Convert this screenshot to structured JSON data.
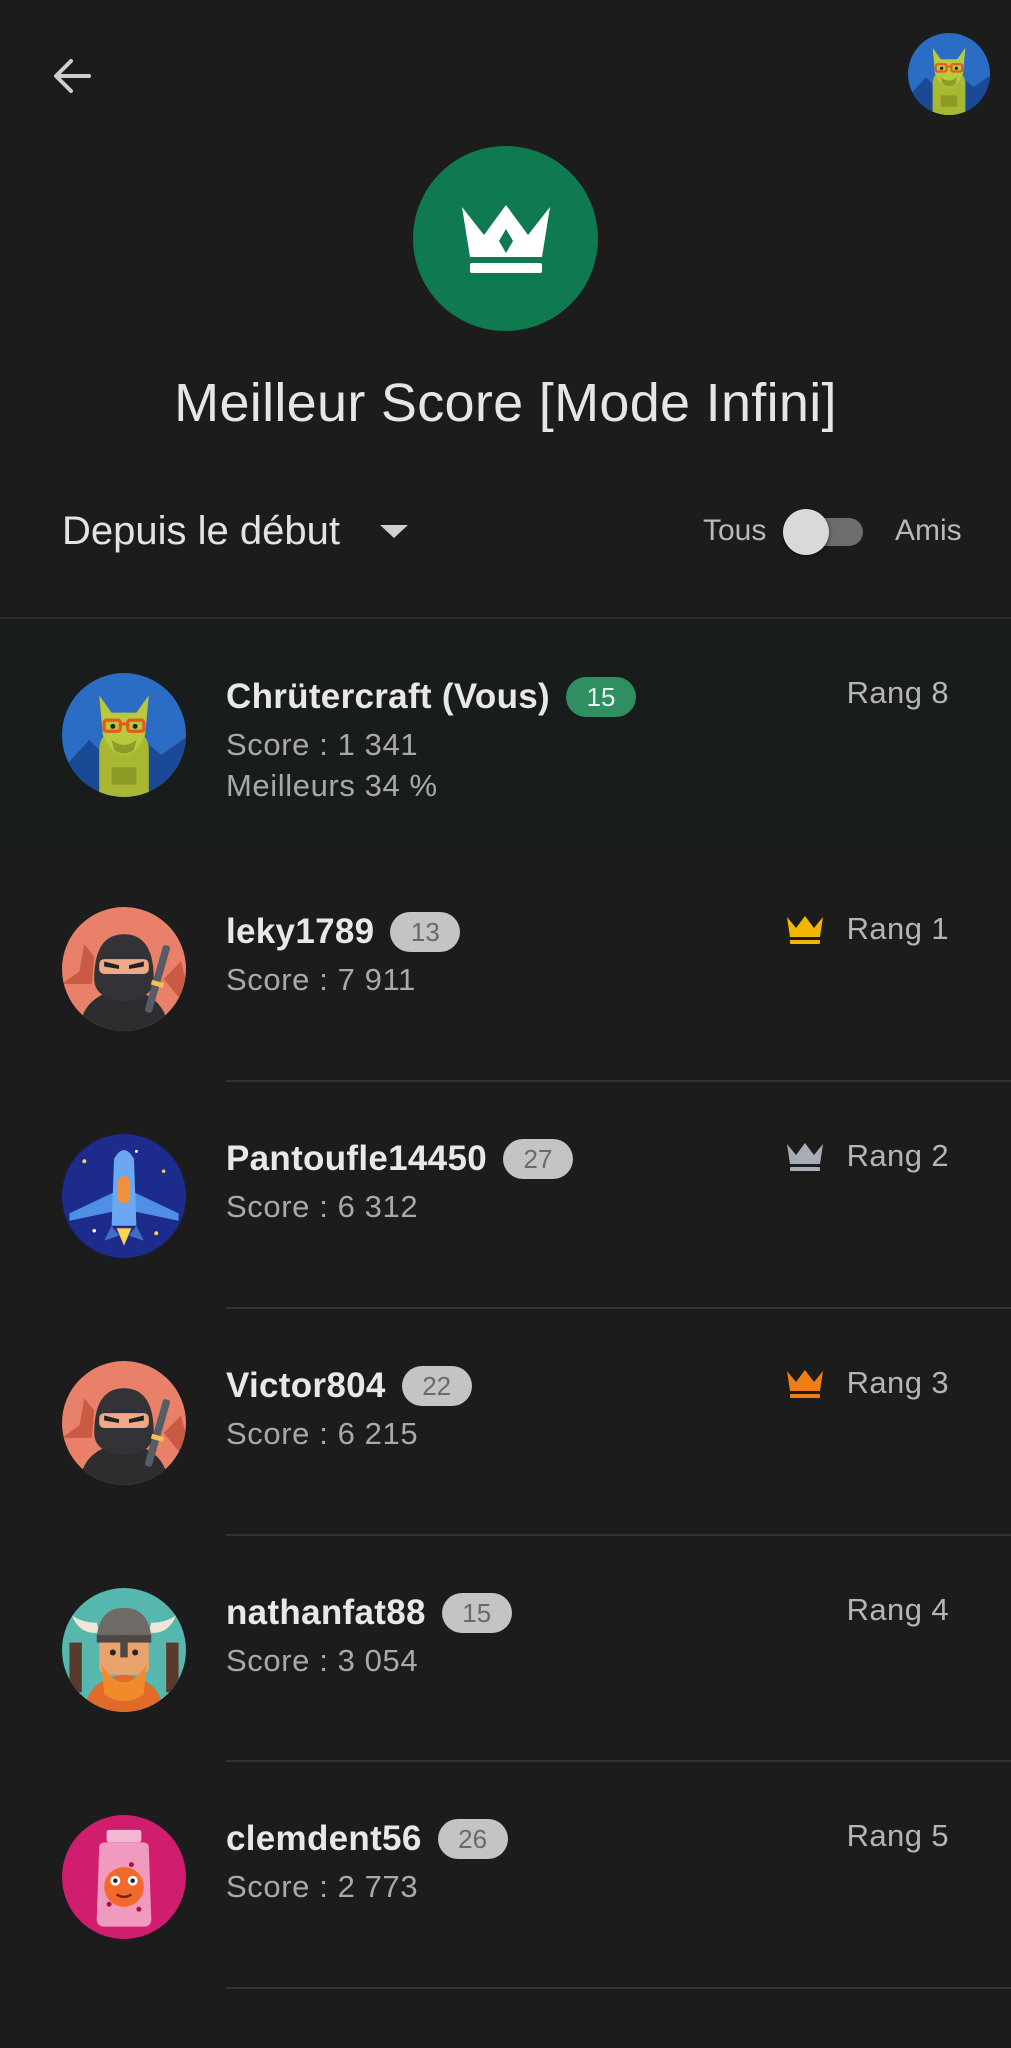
{
  "header": {
    "back_icon": "arrow-back-icon",
    "profile_avatar": "llama-avatar"
  },
  "leaderboard": {
    "icon": "crown-icon",
    "icon_color": "#0f7a4f",
    "title": "Meilleur Score [Mode Infini]"
  },
  "filters": {
    "time_range": "Depuis le début",
    "toggle_left": "Tous",
    "toggle_right": "Amis",
    "friends_only": false
  },
  "current_player": {
    "name": "Chrütercraft (Vous)",
    "level": "15",
    "score": "Score : 1 341",
    "percentile": "Meilleurs 34 %",
    "rank": "Rang 8",
    "avatar": "llama-avatar"
  },
  "players": [
    {
      "name": "leky1789",
      "level": "13",
      "score": "Score : 7 911",
      "rank": "Rang 1",
      "crown": "gold",
      "crown_color": "#f2b705",
      "avatar": "ninja-avatar"
    },
    {
      "name": "Pantoufle14450",
      "level": "27",
      "score": "Score : 6 312",
      "rank": "Rang 2",
      "crown": "silver",
      "crown_color": "#a7adb5",
      "avatar": "spaceship-avatar"
    },
    {
      "name": "Victor804",
      "level": "22",
      "score": "Score : 6 215",
      "rank": "Rang 3",
      "crown": "bronze",
      "crown_color": "#ef7d1a",
      "avatar": "ninja-avatar"
    },
    {
      "name": "nathanfat88",
      "level": "15",
      "score": "Score : 3 054",
      "rank": "Rang 4",
      "crown": "none",
      "avatar": "viking-avatar"
    },
    {
      "name": "clemdent56",
      "level": "26",
      "score": "Score : 2 773",
      "rank": "Rang 5",
      "crown": "none",
      "avatar": "jar-monster-avatar"
    }
  ]
}
